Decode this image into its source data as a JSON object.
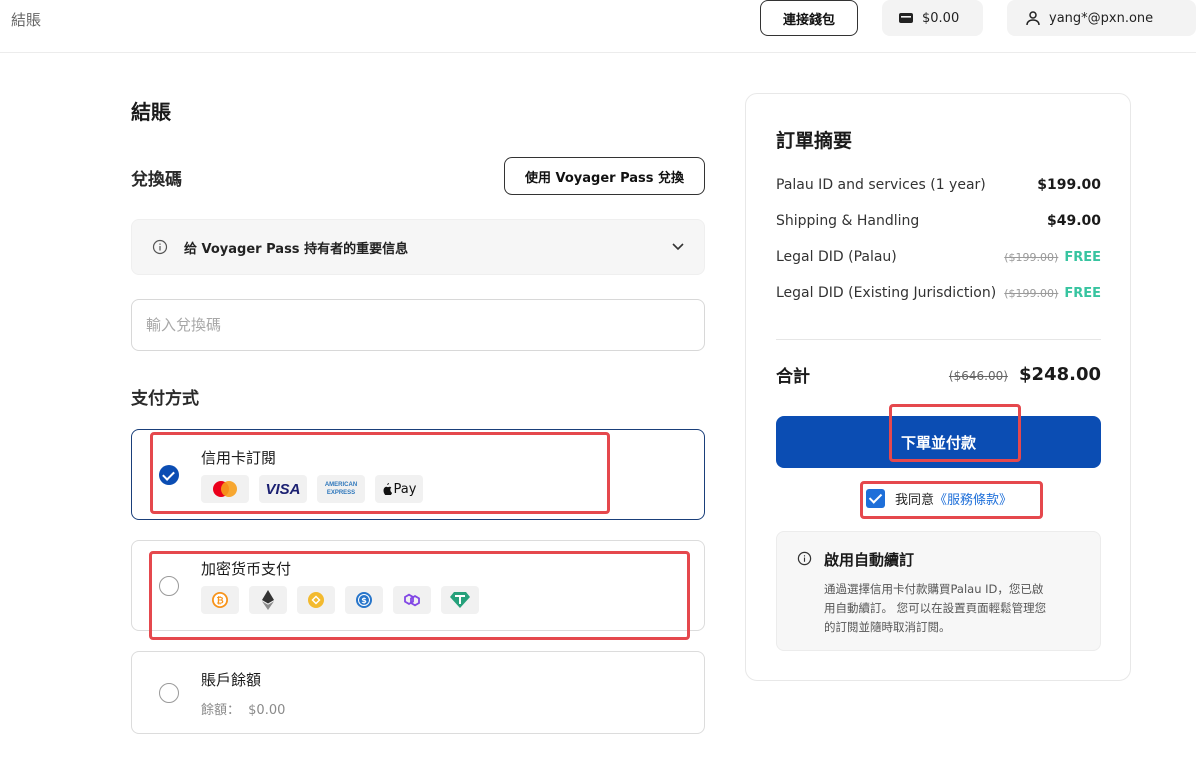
{
  "header": {
    "breadcrumb": "結賬",
    "connect_wallet_label": "連接錢包",
    "balance": "$0.00",
    "user_email": "yang*@pxn.one"
  },
  "checkout": {
    "title": "結賬",
    "redeem": {
      "title": "兌換碼",
      "voyager_button": "使用 Voyager Pass 兌換",
      "info_label": "给 Voyager Pass 持有者的重要信息",
      "code_placeholder": "輸入兌換碼",
      "code_value": ""
    },
    "payment": {
      "title": "支付方式",
      "options": [
        {
          "label": "信用卡訂閱",
          "selected": true,
          "logos": [
            "mastercard-icon",
            "visa-icon",
            "amex-icon",
            "apple-pay-icon"
          ]
        },
        {
          "label": "加密货币支付",
          "selected": false,
          "logos": [
            "bitcoin-icon",
            "ethereum-icon",
            "bnb-icon",
            "usdc-icon",
            "polygon-icon",
            "tether-icon"
          ]
        },
        {
          "label": "賬戶餘額",
          "selected": false,
          "balance_label": "餘額：",
          "balance_value": "$0.00"
        }
      ],
      "card_logo_text": {
        "visa": "VISA",
        "amex_top": "AMERICAN",
        "amex_bottom": "EXPRESS",
        "apple_pay": "Pay"
      }
    }
  },
  "summary": {
    "title": "訂單摘要",
    "items": [
      {
        "name": "Palau ID and services (1 year)",
        "price": "$199.00"
      },
      {
        "name": "Shipping & Handling",
        "price": "$49.00"
      },
      {
        "name": "Legal DID (Palau)",
        "original": "($199.00)",
        "price": "FREE"
      },
      {
        "name": "Legal DID (Existing Jurisdiction)",
        "original": "($199.00)",
        "price": "FREE"
      }
    ],
    "total_label": "合計",
    "total_original": "($646.00)",
    "total": "$248.00",
    "pay_button": "下單並付款",
    "agree_text": "我同意",
    "tos_link": "《服務條款》",
    "agree_checked": true,
    "auto_renew": {
      "title": "啟用自動續訂",
      "body": "通過選擇信用卡付款購買Palau ID，您已啟用自動續訂。 您可以在設置頁面輕鬆管理您的訂閱並隨時取消訂閱。"
    }
  },
  "colors": {
    "primary": "#0b4db3",
    "link": "#1e6fd9",
    "free": "#37c4a0",
    "highlight": "#e5484d"
  }
}
